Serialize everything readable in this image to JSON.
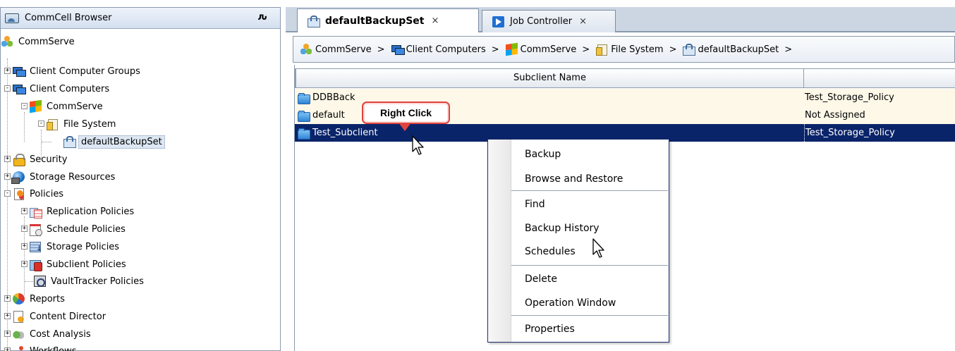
{
  "left_panel": {
    "title": "CommCell Browser",
    "pin_glyph": "ԉ",
    "tree": [
      {
        "label": "CommServe",
        "icon": "commserve-icon"
      },
      {
        "label": "Client Computer Groups",
        "icon": "computers-icon"
      },
      {
        "label": "Client Computers",
        "icon": "computers-icon"
      },
      {
        "label": "CommServe",
        "icon": "windows-icon"
      },
      {
        "label": "File System",
        "icon": "file-system-icon"
      },
      {
        "label": "defaultBackupSet",
        "icon": "backupset-icon",
        "selected": true
      },
      {
        "label": "Security",
        "icon": "lock-icon"
      },
      {
        "label": "Storage Resources",
        "icon": "globe-icon"
      },
      {
        "label": "Policies",
        "icon": "policy-icon"
      },
      {
        "label": "Replication Policies",
        "icon": "replication-icon"
      },
      {
        "label": "Schedule Policies",
        "icon": "schedule-icon"
      },
      {
        "label": "Storage Policies",
        "icon": "storage-icon"
      },
      {
        "label": "Subclient Policies",
        "icon": "subclient-policy-icon"
      },
      {
        "label": "VaultTracker Policies",
        "icon": "vault-icon"
      },
      {
        "label": "Reports",
        "icon": "pie-chart-icon"
      },
      {
        "label": "Content Director",
        "icon": "content-icon"
      },
      {
        "label": "Cost Analysis",
        "icon": "cost-icon"
      },
      {
        "label": "Workflows",
        "icon": "workflow-icon"
      }
    ]
  },
  "tabs": [
    {
      "label": "defaultBackupSet",
      "close": "×",
      "active": true
    },
    {
      "label": "Job Controller",
      "close": "×",
      "active": false
    }
  ],
  "breadcrumb": {
    "items": [
      "CommServe",
      "Client Computers",
      "CommServe",
      "File System",
      "defaultBackupSet"
    ],
    "separator": ">"
  },
  "grid": {
    "columns": [
      "Subclient Name",
      ""
    ],
    "rows": [
      {
        "name": "DDBBack",
        "policy": "Test_Storage_Policy"
      },
      {
        "name": "default",
        "policy": "Not Assigned"
      },
      {
        "name": "Test_Subclient",
        "policy": "Test_Storage_Policy",
        "selected": true
      }
    ]
  },
  "callout": {
    "text": "Right Click"
  },
  "context_menu": {
    "items": [
      "Backup",
      "Browse and Restore",
      "Find",
      "Backup History",
      "Schedules",
      "Delete",
      "Operation Window",
      "Properties"
    ]
  },
  "colors": {
    "selection": "#0a246a",
    "callout_border": "#e0433e",
    "tab_strip": "#ccd6e3"
  }
}
